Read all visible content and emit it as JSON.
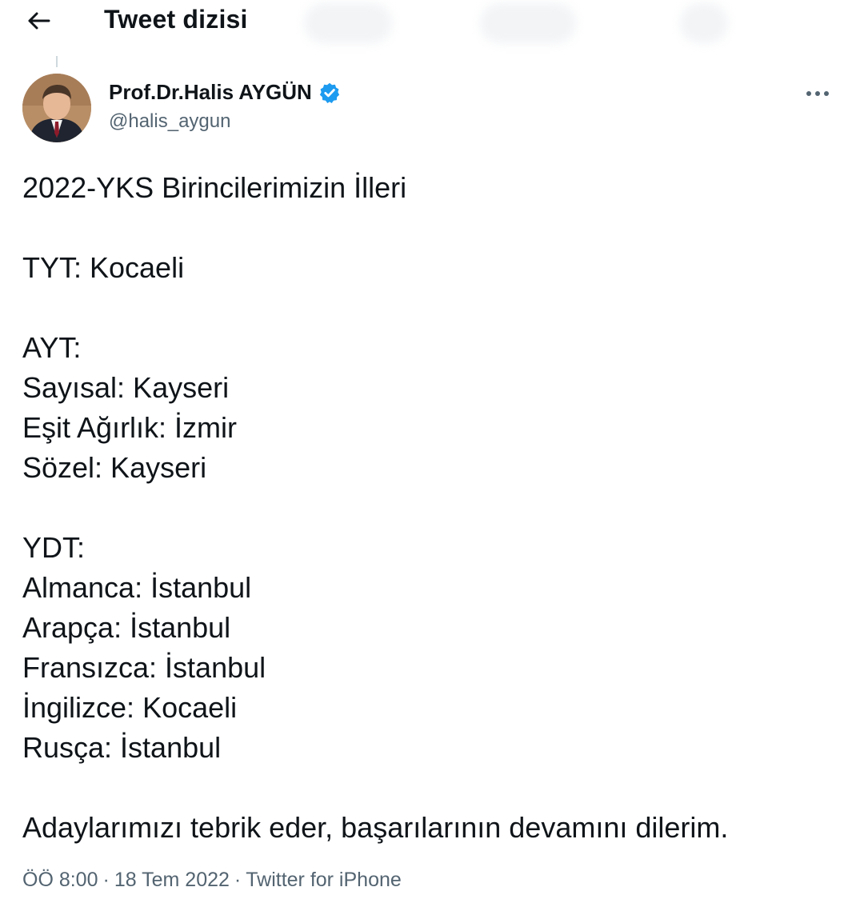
{
  "header": {
    "title": "Tweet dizisi",
    "back_icon": "arrow-left-icon"
  },
  "author": {
    "name": "Prof.Dr.Halis AYGÜN",
    "handle": "@halis_aygun",
    "verified_icon": "verified-badge-icon",
    "verified_color": "#1d9bf0"
  },
  "more_icon": "more-horizontal-icon",
  "tweet": {
    "line1": "2022-YKS Birincilerimizin İlleri",
    "line2": "TYT: Kocaeli",
    "line3": "AYT:",
    "line4": "Sayısal: Kayseri",
    "line5": "Eşit Ağırlık: İzmir",
    "line6": "Sözel: Kayseri",
    "line7": "YDT:",
    "line8": "Almanca: İstanbul",
    "line9": "Arapça: İstanbul",
    "line10": "Fransızca: İstanbul",
    "line11": "İngilizce: Kocaeli",
    "line12": "Rusça: İstanbul",
    "line13": "Adaylarımızı tebrik eder, başarılarının devamını dilerim."
  },
  "meta": {
    "time": "ÖÖ 8:00",
    "sep1": "·",
    "date": "18 Tem 2022",
    "sep2": "·",
    "source": "Twitter for iPhone"
  },
  "colors": {
    "text": "#0f1419",
    "secondary": "#536471",
    "accent": "#1d9bf0"
  }
}
